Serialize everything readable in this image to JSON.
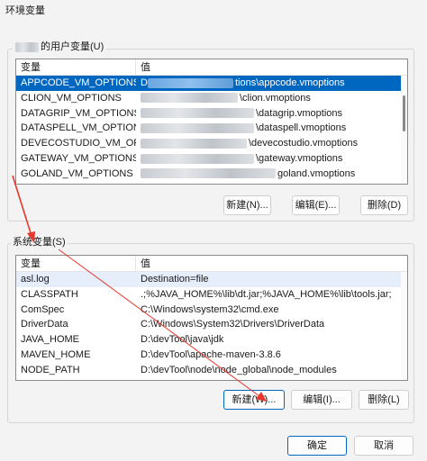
{
  "window": {
    "title": "环境变量"
  },
  "user_section": {
    "label": "的用户变量(U)",
    "header_var": "变量",
    "header_val": "值",
    "rows": [
      {
        "name": "APPCODE_VM_OPTIONS",
        "prefix": "D",
        "suffix": "tions\\appcode.vmoptions"
      },
      {
        "name": "CLION_VM_OPTIONS",
        "prefix": "",
        "suffix": "\\clion.vmoptions"
      },
      {
        "name": "DATAGRIP_VM_OPTIONS",
        "prefix": "",
        "suffix": "\\datagrip.vmoptions"
      },
      {
        "name": "DATASPELL_VM_OPTIONS",
        "prefix": "",
        "suffix": "\\dataspell.vmoptions"
      },
      {
        "name": "DEVECOSTUDIO_VM_OPT...",
        "prefix": "",
        "suffix": "\\devecostudio.vmoptions"
      },
      {
        "name": "GATEWAY_VM_OPTIONS",
        "prefix": "",
        "suffix": "\\gateway.vmoptions"
      },
      {
        "name": "GOLAND_VM_OPTIONS",
        "prefix": "",
        "suffix": "goland.vmoptions"
      }
    ],
    "new_btn": "新建(N)...",
    "edit_btn": "编辑(E)...",
    "delete_btn": "删除(D)"
  },
  "system_section": {
    "label": "系统变量(S)",
    "header_var": "变量",
    "header_val": "值",
    "rows": [
      {
        "name": "asl.log",
        "value": "Destination=file"
      },
      {
        "name": "CLASSPATH",
        "value": ".;%JAVA_HOME%\\lib\\dt.jar;%JAVA_HOME%\\lib\\tools.jar;"
      },
      {
        "name": "ComSpec",
        "value": "C:\\Windows\\system32\\cmd.exe"
      },
      {
        "name": "DriverData",
        "value": "C:\\Windows\\System32\\Drivers\\DriverData"
      },
      {
        "name": "JAVA_HOME",
        "value": "D:\\devTool\\java\\jdk"
      },
      {
        "name": "MAVEN_HOME",
        "value": "D:\\devTool\\apache-maven-3.8.6"
      },
      {
        "name": "NODE_PATH",
        "value": "D:\\devTool\\node\\node_global\\node_modules"
      }
    ],
    "new_btn": "新建(W)...",
    "edit_btn": "编辑(I)...",
    "delete_btn": "删除(L)"
  },
  "footer": {
    "ok_btn": "确定",
    "cancel_btn": "取消"
  },
  "colors": {
    "selection": "#0067c0",
    "annotation_arrow": "#e8372c"
  }
}
